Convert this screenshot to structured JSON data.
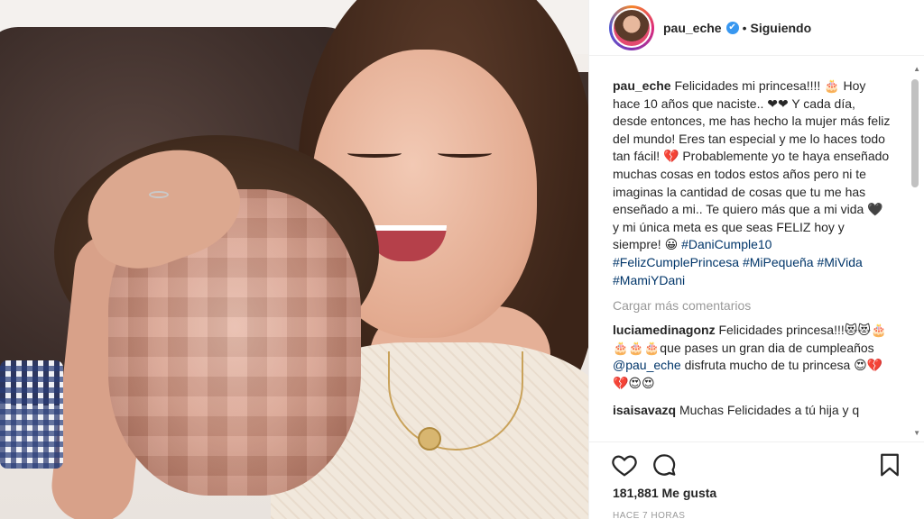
{
  "header": {
    "username": "pau_eche",
    "verified_mark": "✔",
    "separator": "•",
    "follow_status": "Siguiendo"
  },
  "caption": {
    "author": "pau_eche",
    "text_1": " Felicidades mi princesa!!!! 🎂 Hoy hace 10 años que naciste.. ❤❤ Y cada día, desde entonces, me has hecho la mujer más feliz del mundo! Eres tan especial y me lo haces todo tan fácil! 💔 Probablemente yo te haya enseñado muchas cosas en todos estos años pero ni te imaginas la cantidad de cosas que tu me has enseñado a mi.. Te quiero más que a mi vida 🖤 y mi única meta es que seas FELIZ hoy y siempre! 😀 ",
    "hashtags": [
      "#DaniCumple10",
      "#FelizCumplePrincesa",
      "#MiPequeña",
      "#MiVida",
      "#MamiYDani"
    ]
  },
  "load_more": "Cargar más comentarios",
  "comments": [
    {
      "user": "luciamedinagonz",
      "text_1": " Felicidades princesa!!!😻😻🎂🎂🎂🎂que pases un gran dia de cumpleaños ",
      "mention": "@pau_eche",
      "text_2": " disfruta mucho de tu princesa 😍💔💔😍😍"
    },
    {
      "user": "isaisavazq",
      "text_1": " Muchas Felicidades a tú hija y q",
      "mention": "",
      "text_2": ""
    }
  ],
  "actions": {
    "likes": "181,881 Me gusta",
    "time": "HACE 7 HORAS",
    "icons": [
      "heart-icon",
      "comment-icon",
      "bookmark-icon"
    ]
  },
  "colors": {
    "link": "#003569",
    "verified": "#3897f0",
    "muted": "#999999"
  }
}
